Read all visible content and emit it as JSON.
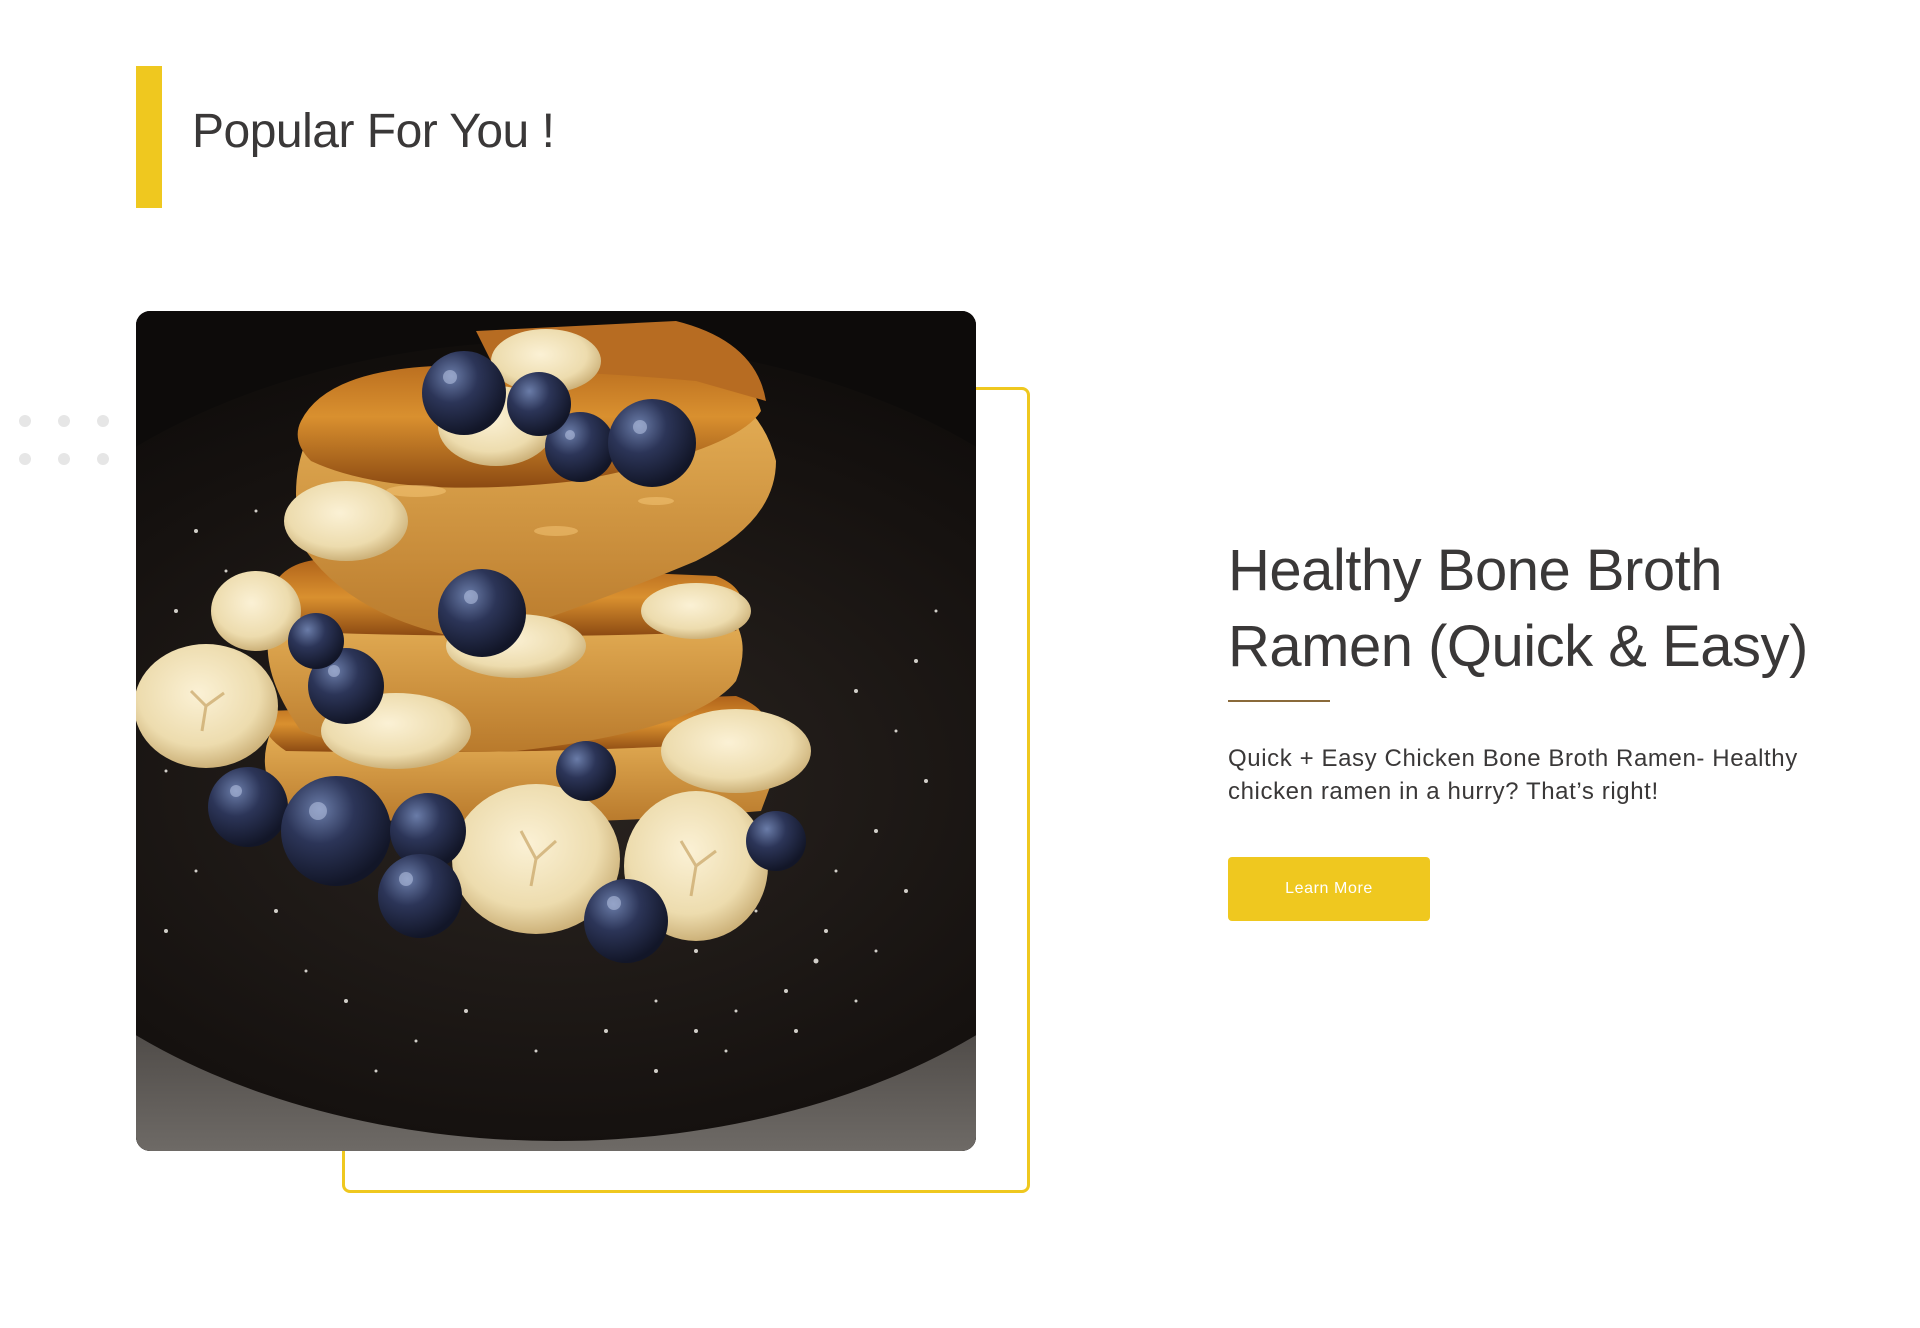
{
  "section": {
    "title": "Popular For You !"
  },
  "featured": {
    "image_alt": "French toast stack with bananas and blueberries",
    "title": "Healthy Bone Broth Ramen (Quick & Easy)",
    "description": "Quick + Easy Chicken Bone Broth Ramen- Healthy chicken ramen in a hurry? That’s right!",
    "button_label": "Learn More"
  },
  "colors": {
    "accent": "#efc81f",
    "text": "#3a3838",
    "rule": "#8a6a3a",
    "dots": "#e6e6e6"
  }
}
